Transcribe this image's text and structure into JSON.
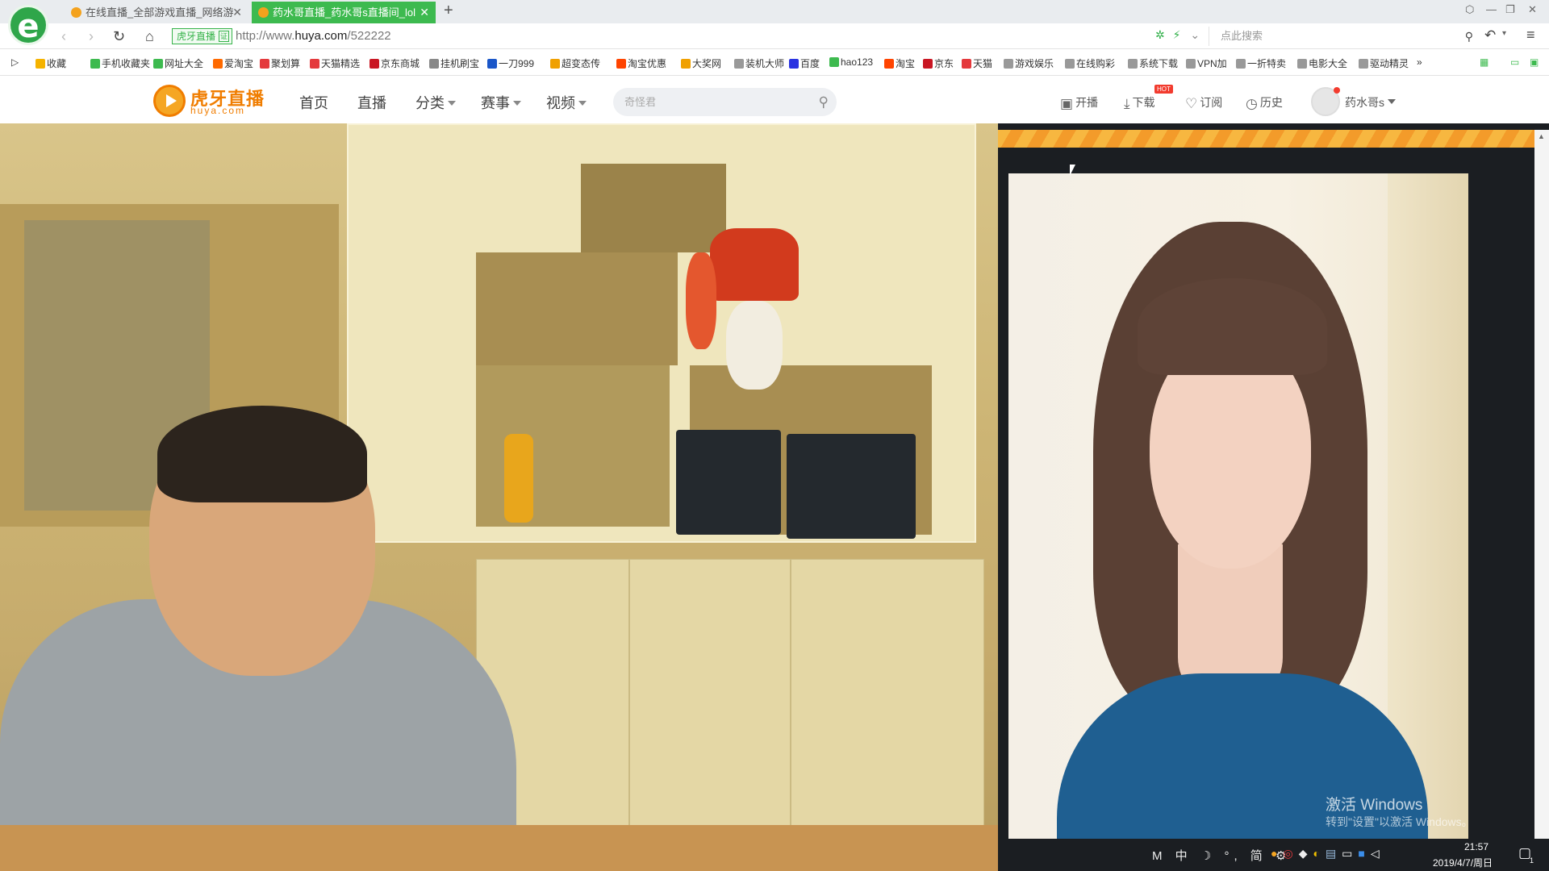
{
  "browser": {
    "tabs": [
      {
        "title": "在线直播_全部游戏直播_网络游"
      },
      {
        "title": "药水哥直播_药水哥s直播间_lol"
      }
    ],
    "site_badge": "虎牙直播",
    "site_badge_cert": "证",
    "url_prefix": "http://www.",
    "url_domain": "huya.com",
    "url_path": "/522222",
    "search_placeholder": "点此搜索",
    "bookmarks": [
      {
        "label": "收藏",
        "color": "#f5b300"
      },
      {
        "label": "手机收藏夹",
        "color": "#3dba4f"
      },
      {
        "label": "网址大全",
        "color": "#3dba4f"
      },
      {
        "label": "爱淘宝",
        "color": "#ff6a00"
      },
      {
        "label": "聚划算",
        "color": "#e4393c"
      },
      {
        "label": "天猫精选",
        "color": "#e4393c"
      },
      {
        "label": "京东商城",
        "color": "#c91623"
      },
      {
        "label": "挂机刷宝",
        "color": "#888888"
      },
      {
        "label": "一刀999",
        "color": "#1a56c8"
      },
      {
        "label": "超变态传",
        "color": "#f0a000"
      },
      {
        "label": "淘宝优惠",
        "color": "#ff4400"
      },
      {
        "label": "大奖网",
        "color": "#f0a000"
      },
      {
        "label": "装机大师",
        "color": "#999999"
      },
      {
        "label": "百度",
        "color": "#2932e1"
      },
      {
        "label": "hao123",
        "color": "#3dba4f"
      },
      {
        "label": "淘宝",
        "color": "#ff4400"
      },
      {
        "label": "京东",
        "color": "#c91623"
      },
      {
        "label": "天猫",
        "color": "#e4393c"
      },
      {
        "label": "游戏娱乐",
        "color": "#999999"
      },
      {
        "label": "在线购彩",
        "color": "#999999"
      },
      {
        "label": "系统下载",
        "color": "#999999"
      },
      {
        "label": "VPN加",
        "color": "#999999"
      },
      {
        "label": "一折特卖",
        "color": "#999999"
      },
      {
        "label": "电影大全",
        "color": "#999999"
      },
      {
        "label": "驱动精灵",
        "color": "#999999"
      }
    ],
    "bookmark_more": "»"
  },
  "site": {
    "logo_name": "虎牙直播",
    "logo_domain": "huya.com",
    "nav": [
      "首页",
      "直播",
      "分类",
      "赛事",
      "视频"
    ],
    "search_placeholder": "奇怪君",
    "actions": {
      "broadcast": "开播",
      "download": "下载",
      "hot": "HOT",
      "subscribe": "订阅",
      "history": "历史"
    },
    "username": "药水哥s"
  },
  "overlay": {
    "watermark_title": "激活 Windows",
    "watermark_sub": "转到\"设置\"以激活 Windows。"
  },
  "taskbar": {
    "tray_icons": "M 中 ☽ °, 简 ⚙",
    "time": "21:57",
    "date": "2019/4/7/周日",
    "notify_count": "1"
  },
  "colors": {
    "accent": "#f07d00",
    "tab_active": "#3dba4f"
  }
}
